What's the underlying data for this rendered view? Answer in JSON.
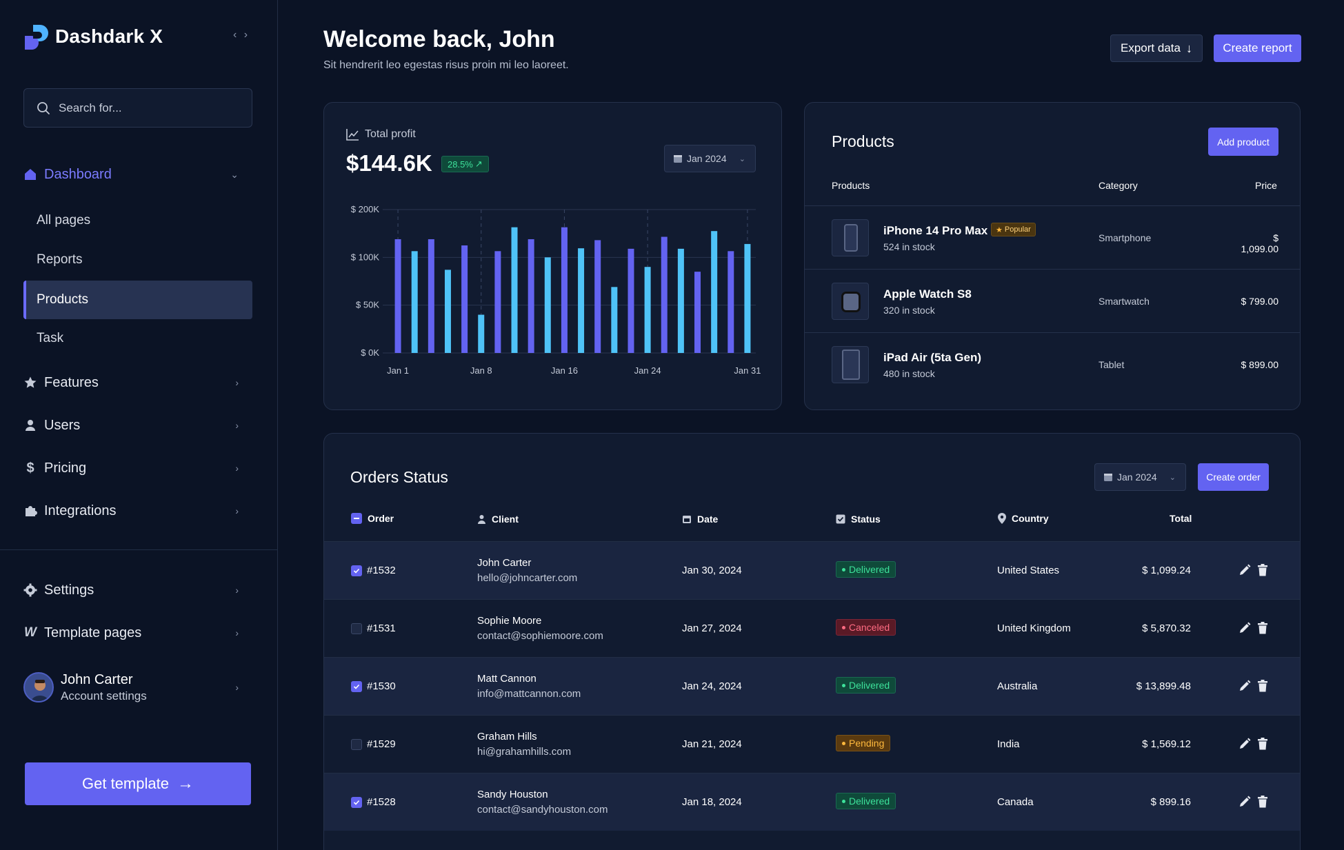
{
  "sidebar": {
    "brand": "Dashdark X",
    "search_placeholder": "Search for...",
    "dashboard_label": "Dashboard",
    "sub_items": [
      "All pages",
      "Reports",
      "Products",
      "Task"
    ],
    "items": [
      "Features",
      "Users",
      "Pricing",
      "Integrations"
    ],
    "settings_label": "Settings",
    "template_pages_label": "Template pages",
    "profile_name": "John Carter",
    "profile_sub": "Account settings",
    "cta": "Get template"
  },
  "header": {
    "title": "Welcome back, John",
    "subtitle": "Sit hendrerit leo egestas risus proin mi leo laoreet.",
    "export_label": "Export data",
    "create_report_label": "Create report"
  },
  "profit": {
    "label": "Total profit",
    "value": "$144.6K",
    "change": "28.5%",
    "date_filter": "Jan 2024"
  },
  "chart_data": {
    "type": "bar",
    "title": "Total profit",
    "x_tick_labels": [
      "Jan 1",
      "Jan 8",
      "Jan 16",
      "Jan 24",
      "Jan 31"
    ],
    "y_tick_labels": [
      "$ 200K",
      "$ 100K",
      "$ 50K",
      "$ 0K"
    ],
    "ylim": [
      0,
      200
    ],
    "grid": true,
    "values": [
      138,
      113,
      138,
      87,
      125,
      40,
      113,
      163,
      138,
      100,
      163,
      119,
      136,
      69,
      118,
      90,
      143,
      118,
      85,
      155,
      113,
      128
    ],
    "colors": [
      "#6363f1",
      "#4fc3f7",
      "#6363f1",
      "#4fc3f7",
      "#6363f1",
      "#4fc3f7",
      "#6363f1",
      "#4fc3f7",
      "#6363f1",
      "#4fc3f7",
      "#6363f1",
      "#4fc3f7",
      "#6363f1",
      "#4fc3f7",
      "#6363f1",
      "#4fc3f7",
      "#6363f1",
      "#4fc3f7",
      "#6363f1",
      "#4fc3f7",
      "#6363f1",
      "#4fc3f7"
    ]
  },
  "products": {
    "title": "Products",
    "add_label": "Add product",
    "columns": [
      "Products",
      "Category",
      "Price"
    ],
    "rows": [
      {
        "name": "iPhone 14 Pro Max",
        "badge": "Popular",
        "stock": "524 in stock",
        "category": "Smartphone",
        "price": "$ 1,099.00"
      },
      {
        "name": "Apple Watch S8",
        "badge": "",
        "stock": "320 in stock",
        "category": "Smartwatch",
        "price": "$ 799.00"
      },
      {
        "name": "iPad Air (5ta Gen)",
        "badge": "",
        "stock": "480 in stock",
        "category": "Tablet",
        "price": "$ 899.00"
      }
    ]
  },
  "orders": {
    "title": "Orders Status",
    "date_filter": "Jan 2024",
    "create_label": "Create order",
    "columns": [
      "Order",
      "Client",
      "Date",
      "Status",
      "Country",
      "Total"
    ],
    "rows": [
      {
        "id": "#1532",
        "client": "John Carter",
        "email": "hello@johncarter.com",
        "date": "Jan 30, 2024",
        "status": "Delivered",
        "country": "United States",
        "total": "$ 1,099.24",
        "checked": true
      },
      {
        "id": "#1531",
        "client": "Sophie Moore",
        "email": "contact@sophiemoore.com",
        "date": "Jan 27, 2024",
        "status": "Canceled",
        "country": "United Kingdom",
        "total": "$ 5,870.32",
        "checked": false
      },
      {
        "id": "#1530",
        "client": "Matt Cannon",
        "email": "info@mattcannon.com",
        "date": "Jan 24, 2024",
        "status": "Delivered",
        "country": "Australia",
        "total": "$ 13,899.48",
        "checked": true
      },
      {
        "id": "#1529",
        "client": "Graham Hills",
        "email": "hi@grahamhills.com",
        "date": "Jan 21, 2024",
        "status": "Pending",
        "country": "India",
        "total": "$ 1,569.12",
        "checked": false
      },
      {
        "id": "#1528",
        "client": "Sandy Houston",
        "email": "contact@sandyhouston.com",
        "date": "Jan 18, 2024",
        "status": "Delivered",
        "country": "Canada",
        "total": "$ 899.16",
        "checked": true
      }
    ]
  },
  "colors": {
    "accent": "#6363f1",
    "secondary_bar": "#4fc3f7",
    "background": "#0b1325",
    "card": "#111b30"
  }
}
